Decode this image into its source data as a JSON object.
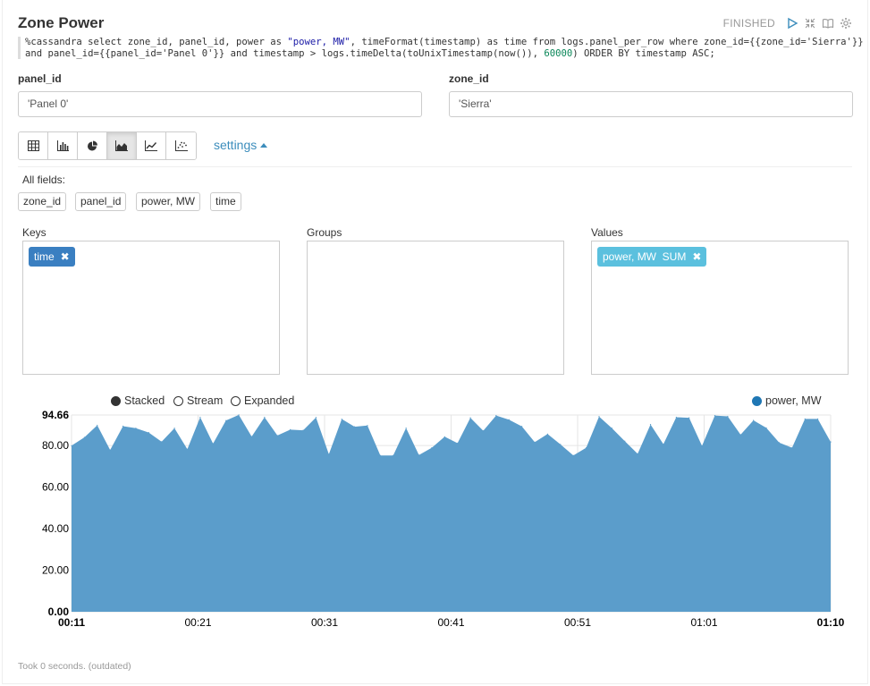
{
  "paragraph": {
    "title": "Zone Power",
    "status": "FINISHED",
    "code_line1_pre": "%cassandra select zone_id, panel_id, power as ",
    "code_line1_str": "\"power, MW\"",
    "code_line1_post": ", timeFormat(timestamp) as time from logs.panel_per_row where zone_id={{zone_id='Sierra'}}",
    "code_line2_pre": "and panel_id={{panel_id='Panel 0'}} and timestamp > logs.timeDelta(toUnixTimestamp(now()), ",
    "code_line2_num": "60000",
    "code_line2_post": ") ORDER BY timestamp ASC;",
    "icons": [
      "play-icon",
      "collapse-icon",
      "book-icon",
      "gear-icon"
    ]
  },
  "form": {
    "panel_label": "panel_id",
    "panel_value": "'Panel 0'",
    "zone_label": "zone_id",
    "zone_value": "'Sierra'"
  },
  "toolbar": {
    "buttons": [
      "table-icon",
      "bar-chart-icon",
      "pie-chart-icon",
      "area-chart-icon",
      "line-chart-icon",
      "scatter-chart-icon"
    ],
    "active": "area-chart-icon",
    "settings_label": "settings"
  },
  "fields": {
    "label": "All fields:",
    "items": [
      "zone_id",
      "panel_id",
      "power, MW",
      "time"
    ]
  },
  "pivot": {
    "keys_label": "Keys",
    "groups_label": "Groups",
    "values_label": "Values",
    "keys_tag": "time",
    "values_tag": "power, MW  SUM"
  },
  "chart_controls": {
    "stacked": "Stacked",
    "stream": "Stream",
    "expanded": "Expanded",
    "selected": "Stacked",
    "series_legend": "power, MW"
  },
  "colors": {
    "area_fill": "#5b9dcb",
    "series": "#1f77b4",
    "tag_keys": "#3a7fc1",
    "tag_values": "#5bc0de",
    "link": "#3c8dbc"
  },
  "chart_data": {
    "type": "area",
    "series": [
      {
        "name": "power, MW",
        "values": [
          79.9,
          83.9,
          89.7,
          77.8,
          89.3,
          88.3,
          86.2,
          81.8,
          88.3,
          78.2,
          93.6,
          80.9,
          92.0,
          94.7,
          84.3,
          93.6,
          84.8,
          87.6,
          87.3,
          93.5,
          75.8,
          92.7,
          89.0,
          89.6,
          75.2,
          75.2,
          88.4,
          75.4,
          78.9,
          84.2,
          81.1,
          93.3,
          87.1,
          94.4,
          92.4,
          89.2,
          81.6,
          85.5,
          80.5,
          75.2,
          78.9,
          93.9,
          88.3,
          82.1,
          76.0,
          90.1,
          80.6,
          93.6,
          93.3,
          79.8,
          94.4,
          94.0,
          85.2,
          92.1,
          88.5,
          81.4,
          78.9,
          92.8,
          92.8,
          81.7
        ]
      }
    ],
    "x_ticks": [
      "00:11",
      "00:21",
      "00:31",
      "00:41",
      "00:51",
      "01:01",
      "01:10"
    ],
    "y_ticks": [
      "0.00",
      "20.00",
      "40.00",
      "60.00",
      "80.00",
      "94.66"
    ],
    "ylim": [
      0,
      94.66
    ],
    "grid": true,
    "legend_position": "top-right"
  },
  "footer": "Took 0 seconds. (outdated)"
}
